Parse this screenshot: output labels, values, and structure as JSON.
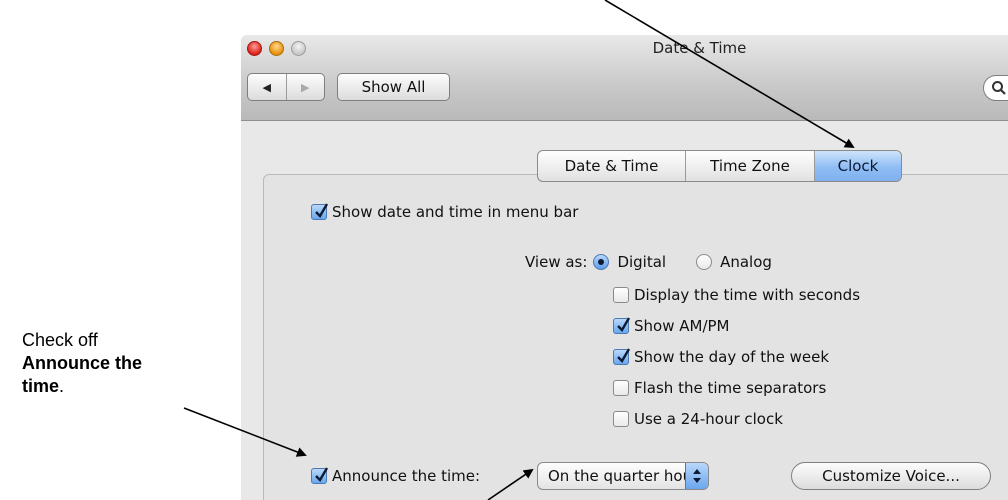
{
  "window": {
    "title": "Date & Time",
    "toolbar": {
      "back_icon": "back-arrow-icon",
      "forward_icon": "forward-arrow-icon",
      "show_all": "Show All",
      "search_icon": "search-icon"
    }
  },
  "tabs": [
    {
      "label": "Date & Time",
      "selected": false
    },
    {
      "label": "Time Zone",
      "selected": false
    },
    {
      "label": "Clock",
      "selected": true
    }
  ],
  "options": {
    "show_in_menu_bar": {
      "label": "Show date and time in menu bar",
      "checked": true
    },
    "view_as_label": "View as:",
    "view_as_digital": {
      "label": "Digital",
      "selected": true
    },
    "view_as_analog": {
      "label": "Analog",
      "selected": false
    },
    "display_seconds": {
      "label": "Display the time with seconds",
      "checked": false
    },
    "show_ampm": {
      "label": "Show AM/PM",
      "checked": true
    },
    "show_day_of_week": {
      "label": "Show the day of the week",
      "checked": true
    },
    "flash_separators": {
      "label": "Flash the time separators",
      "checked": false
    },
    "use_24h": {
      "label": "Use a 24-hour clock",
      "checked": false
    },
    "announce_time": {
      "label": "Announce the time:",
      "checked": true
    },
    "announce_interval": "On the quarter hour",
    "customize_voice": "Customize Voice..."
  },
  "annotation": {
    "line1": "Check off",
    "bold": "Announce the time",
    "period": "."
  }
}
